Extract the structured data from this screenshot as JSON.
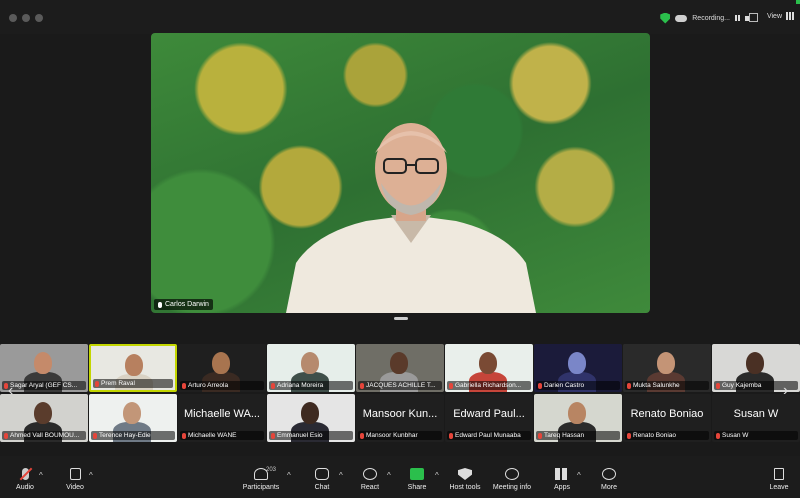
{
  "window": {
    "recording_label": "Recording...",
    "view_label": "View"
  },
  "speaker": {
    "name": "Carlos Darwin"
  },
  "gallery": {
    "row1": [
      {
        "name": "Sagar Aryal (GEF CS...",
        "muted": true,
        "bg": "#9a9a9a",
        "skin": "#c58a6a",
        "shirt": "#3a3a3a"
      },
      {
        "name": "Prem Raval",
        "muted": true,
        "bg": "#e8e8e2",
        "skin": "#b7805f",
        "shirt": "#d9d2c4",
        "active": true
      },
      {
        "name": "Arturo Arreola",
        "muted": true,
        "bg": "#1f1f1f",
        "skin": "#a8744f",
        "shirt": "#3a2a22"
      },
      {
        "name": "Adriana Moreira",
        "muted": true,
        "bg": "#e6eeea",
        "skin": "#b68a6e",
        "shirt": "#3f4f4a"
      },
      {
        "name": "JACQUES ACHILLE T...",
        "muted": true,
        "bg": "#6f6e66",
        "skin": "#5a3a2a",
        "shirt": "#9a9a9a"
      },
      {
        "name": "Gabriella Richardson...",
        "muted": true,
        "bg": "#e9efeb",
        "skin": "#7a4a34",
        "shirt": "#c6453a"
      },
      {
        "name": "Darien Castro",
        "muted": true,
        "bg": "#1b1b3a",
        "skin": "#7a86c8",
        "shirt": "#30336a"
      },
      {
        "name": "Mukta Salunkhe",
        "muted": true,
        "bg": "#2a2a2a",
        "skin": "#c49476",
        "shirt": "#5a3a32"
      },
      {
        "name": "Guy Kajemba",
        "muted": true,
        "bg": "#d8d8d6",
        "skin": "#4a3024",
        "shirt": "#2a2a2a"
      }
    ],
    "row2": [
      {
        "name": "Ahmed Vall BOUMOU...",
        "muted": true,
        "bg": "#d2d2ce",
        "skin": "#5a3c2c",
        "shirt": "#2a2a2a"
      },
      {
        "name": "Terence Hay-Edie",
        "muted": true,
        "bg": "#eef1ef",
        "skin": "#c29678",
        "shirt": "#6f7a86"
      },
      {
        "name": "Michaelle WANE",
        "big": "Michaelle WA...",
        "muted": true
      },
      {
        "name": "Emmanuel Esio",
        "muted": true,
        "bg": "#e5e5e5",
        "skin": "#3e2a20",
        "shirt": "#2a2a33"
      },
      {
        "name": "Mansoor Kunbhar",
        "big": "Mansoor Kun...",
        "muted": true
      },
      {
        "name": "Edward Paul Munaaba",
        "big": "Edward Paul...",
        "muted": true
      },
      {
        "name": "Tareq Hassan",
        "muted": true,
        "bg": "#d5d7cf",
        "skin": "#b88563",
        "shirt": "#2b2b2b"
      },
      {
        "name": "Renato Boniao",
        "big": "Renato Boniao",
        "muted": true
      },
      {
        "name": "Susan W",
        "big": "Susan W",
        "muted": true
      }
    ]
  },
  "toolbar": {
    "audio": "Audio",
    "video": "Video",
    "participants": "Participants",
    "participant_count": "203",
    "chat": "Chat",
    "react": "React",
    "share": "Share",
    "host_tools": "Host tools",
    "meeting_info": "Meeting info",
    "apps": "Apps",
    "more": "More",
    "leave": "Leave"
  }
}
